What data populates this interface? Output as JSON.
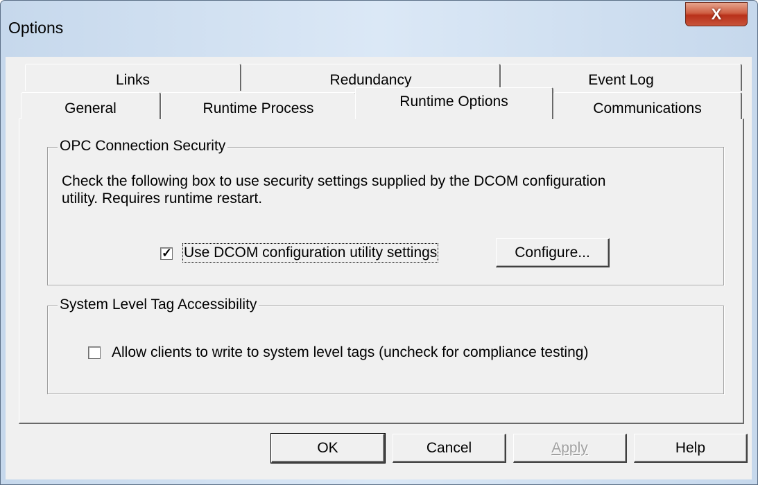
{
  "window": {
    "title": "Options",
    "close_label": "X"
  },
  "tabs": {
    "back_row": [
      {
        "label": "Links"
      },
      {
        "label": "Redundancy"
      },
      {
        "label": "Event Log"
      }
    ],
    "front_row": [
      {
        "label": "General"
      },
      {
        "label": "Runtime Process"
      },
      {
        "label": "Runtime Options",
        "selected": true
      },
      {
        "label": "Communications"
      }
    ]
  },
  "opc_security": {
    "legend": "OPC Connection Security",
    "description_line1": "Check the following box to use security settings supplied by the DCOM configuration",
    "description_line2": "utility.  Requires runtime restart.",
    "use_dcom_label": "Use DCOM configuration utility settings",
    "use_dcom_checked": true,
    "configure_label": "Configure..."
  },
  "system_tags": {
    "legend": "System Level Tag Accessibility",
    "allow_write_label": "Allow clients to write to system level tags (uncheck for compliance testing)",
    "allow_write_checked": false
  },
  "buttons": {
    "ok": "OK",
    "cancel": "Cancel",
    "apply": "Apply",
    "help": "Help"
  },
  "colors": {
    "dialog_bg": "#f0f0f0",
    "close_button": "#c8533a",
    "disabled_text": "#a0a0a0"
  }
}
